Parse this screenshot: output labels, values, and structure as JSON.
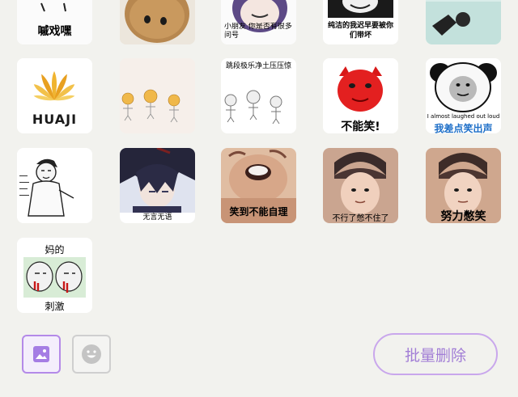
{
  "stickers": [
    {
      "id": "r0c0",
      "caption": "嘁戏嘿"
    },
    {
      "id": "r0c1",
      "caption": ""
    },
    {
      "id": "r0c2",
      "caption": "小朋友 你是否有很多问号"
    },
    {
      "id": "r0c3",
      "caption": "纯洁的我迟早要被你们带坏"
    },
    {
      "id": "r0c4",
      "caption": ""
    },
    {
      "id": "r1c0",
      "caption": "HUAJI"
    },
    {
      "id": "r1c1",
      "caption": ""
    },
    {
      "id": "r1c2",
      "caption": "跳段极乐净土压压惊"
    },
    {
      "id": "r1c3",
      "caption": "不能笑!"
    },
    {
      "id": "r1c4",
      "caption_top": "I almost laughed out loud",
      "caption_bottom": "我差点笑出声"
    },
    {
      "id": "r2c0",
      "caption": ""
    },
    {
      "id": "r2c1",
      "caption": "无言无语"
    },
    {
      "id": "r2c2",
      "caption": "笑到不能自理"
    },
    {
      "id": "r2c3",
      "caption": "不行了憋不住了"
    },
    {
      "id": "r2c4",
      "caption": "努力憋笑"
    },
    {
      "id": "r3c0",
      "caption_top": "妈的",
      "caption_bottom": "刺激"
    }
  ],
  "bottom_bar": {
    "image_tab_icon": "image-icon",
    "emoji_tab_icon": "smiley-face-icon",
    "batch_delete_label": "批量删除"
  },
  "colors": {
    "background": "#f2f2ee",
    "accent": "#b48ae8",
    "accent_text": "#a27ed6"
  }
}
